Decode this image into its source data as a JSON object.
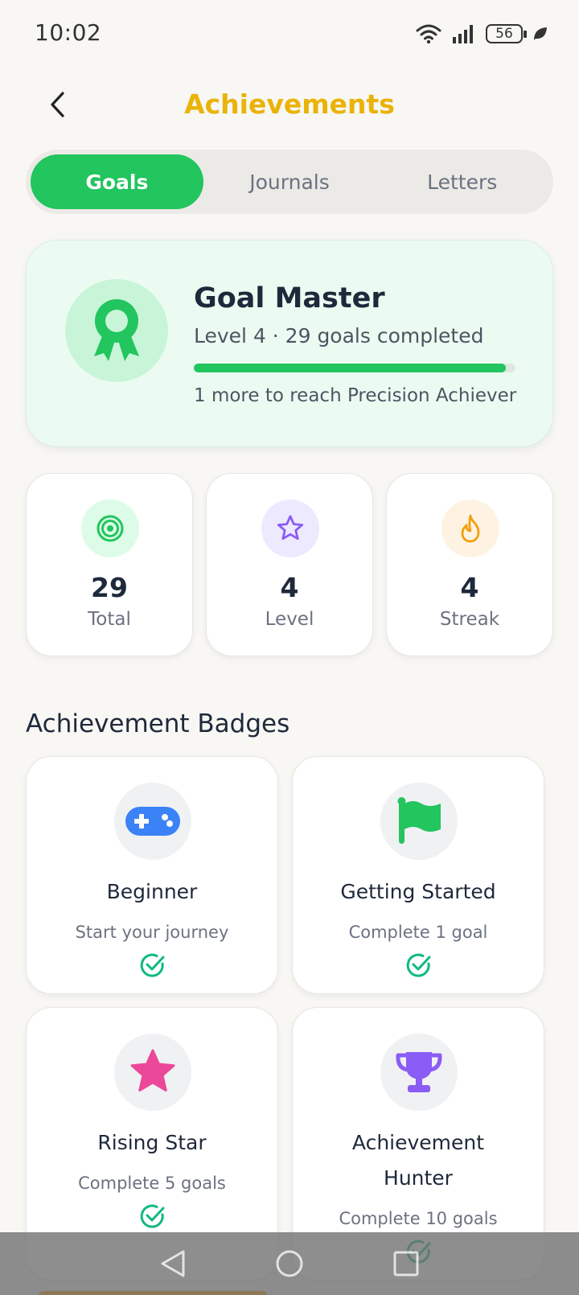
{
  "status_bar": {
    "time": "10:02",
    "battery": "56"
  },
  "header": {
    "title": "Achievements"
  },
  "tabs": [
    {
      "label": "Goals",
      "active": true
    },
    {
      "label": "Journals",
      "active": false
    },
    {
      "label": "Letters",
      "active": false
    }
  ],
  "hero": {
    "title": "Goal Master",
    "subtitle": "Level 4 · 29 goals completed",
    "progress": 0.97,
    "next_text": "1 more to reach Precision Achiever",
    "icon": "award-ribbon-icon"
  },
  "stats": [
    {
      "value": "29",
      "label": "Total",
      "icon": "target-icon",
      "bg": "#dcfce7",
      "color": "#22c55e"
    },
    {
      "value": "4",
      "label": "Level",
      "icon": "star-outline-icon",
      "bg": "#ede9fe",
      "color": "#8b5cf6"
    },
    {
      "value": "4",
      "label": "Streak",
      "icon": "flame-icon",
      "bg": "#fef3e2",
      "color": "#f59e0b"
    }
  ],
  "section_title": "Achievement Badges",
  "badges": [
    {
      "title": "Beginner",
      "desc": "Start your journey",
      "icon": "gamepad-icon",
      "color": "#3b82f6",
      "completed": true
    },
    {
      "title": "Getting Started",
      "desc": "Complete 1 goal",
      "icon": "flag-icon",
      "color": "#22c55e",
      "completed": true
    },
    {
      "title": "Rising Star",
      "desc": "Complete 5 goals",
      "icon": "star-icon",
      "color": "#ec4899",
      "completed": true
    },
    {
      "title_line1": "Achievement",
      "title_line2": "Hunter",
      "desc": "Complete 10 goals",
      "icon": "trophy-icon",
      "color": "#8b5cf6",
      "completed": true
    }
  ],
  "colors": {
    "accent": "#22c55e",
    "title": "#eab308",
    "check": "#10b981"
  }
}
